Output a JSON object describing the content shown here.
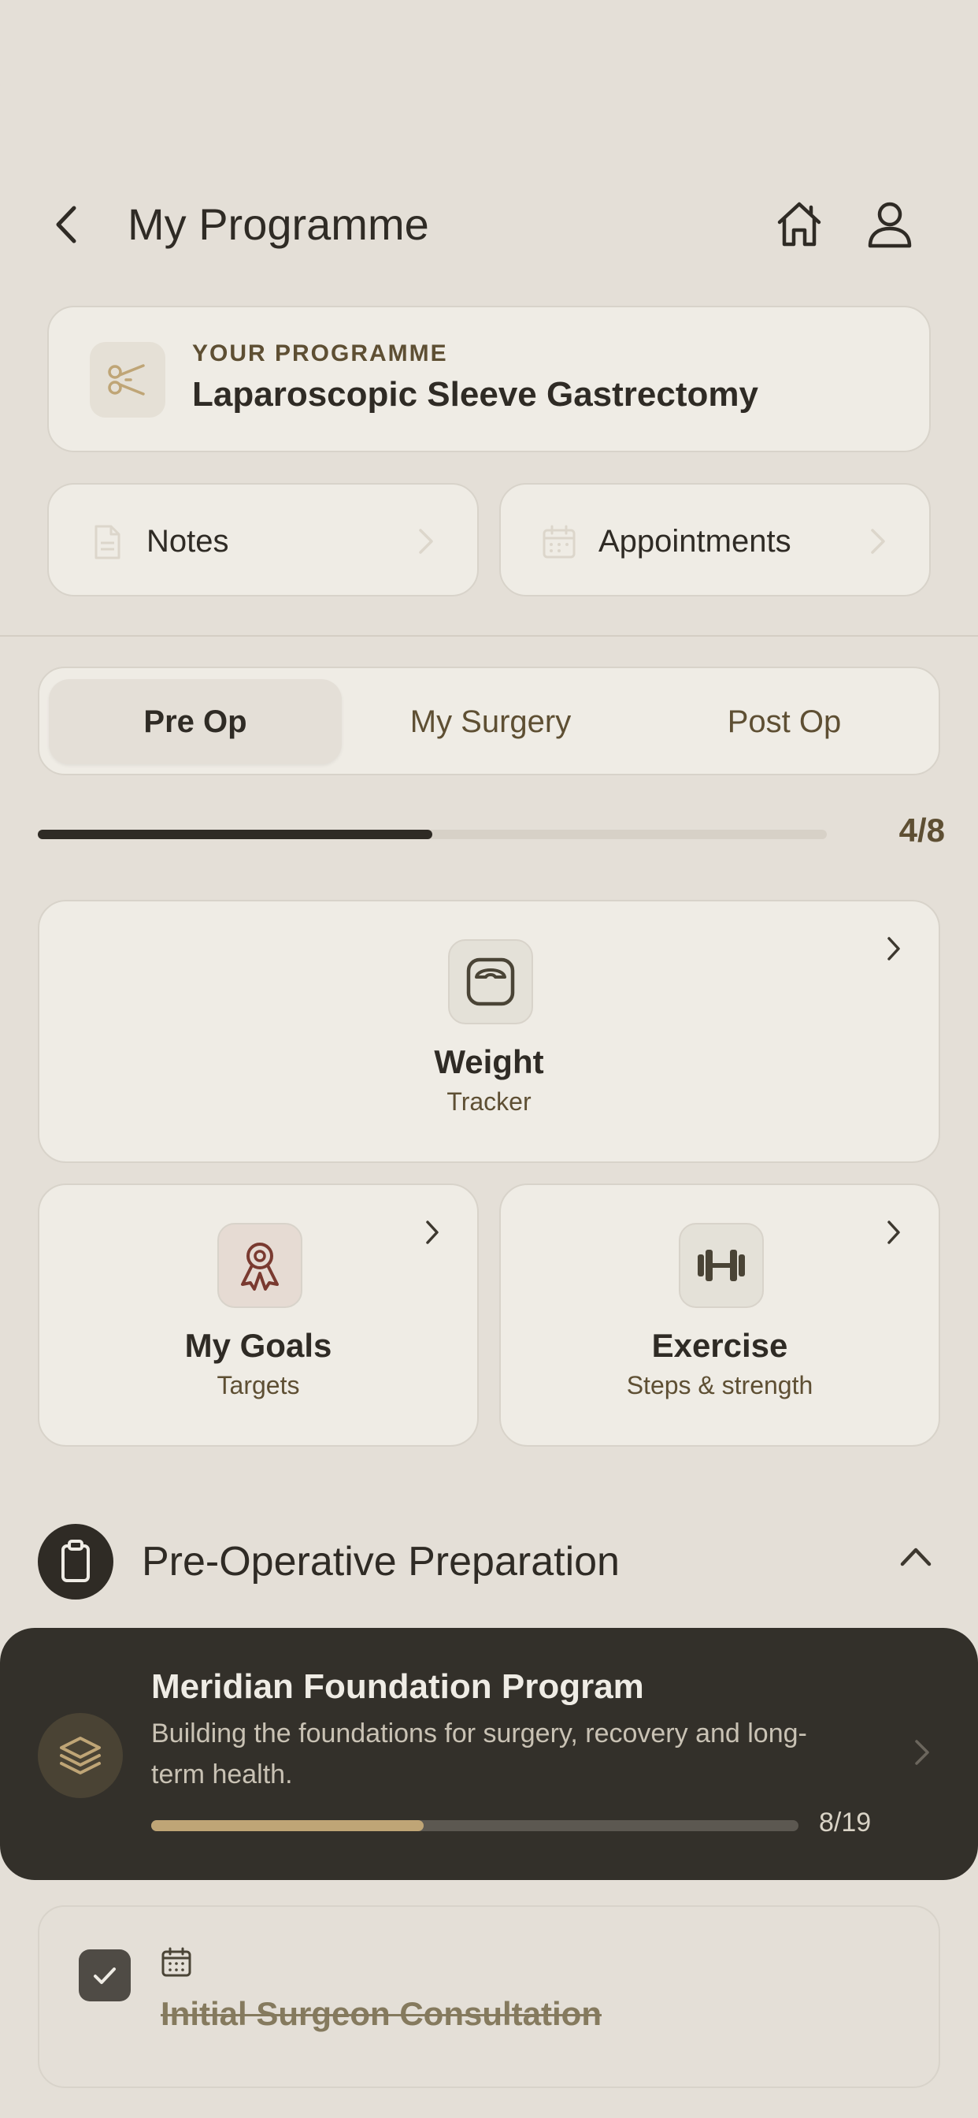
{
  "header": {
    "title": "My Programme",
    "back_icon": "chevron-left-icon",
    "home_icon": "home-icon",
    "profile_icon": "user-icon"
  },
  "programme": {
    "label": "YOUR PROGRAMME",
    "name": "Laparoscopic Sleeve Gastrectomy",
    "icon": "scissors-icon"
  },
  "links": [
    {
      "label": "Notes",
      "icon": "document-icon"
    },
    {
      "label": "Appointments",
      "icon": "calendar-icon"
    }
  ],
  "tabs": [
    {
      "label": "Pre Op",
      "active": true
    },
    {
      "label": "My Surgery",
      "active": false
    },
    {
      "label": "Post Op",
      "active": false
    }
  ],
  "progress": {
    "label": "4/8",
    "value": 4,
    "total": 8
  },
  "tiles": [
    {
      "title": "Weight",
      "subtitle": "Tracker",
      "icon": "scale-icon"
    },
    {
      "title": "My Goals",
      "subtitle": "Targets",
      "icon": "award-ribbon-icon"
    },
    {
      "title": "Exercise",
      "subtitle": "Steps & strength",
      "icon": "dumbbell-icon"
    }
  ],
  "section": {
    "title": "Pre-Operative Preparation",
    "icon": "clipboard-icon",
    "toggle_icon": "chevron-up-icon"
  },
  "program_card": {
    "title": "Meridian Foundation Program",
    "description": "Building the foundations for surgery, recovery and long-term health.",
    "progress_label": "8/19",
    "progress_value": 8,
    "progress_total": 19,
    "icon": "layers-icon"
  },
  "task": {
    "title": "Initial Surgeon Consultation",
    "completed": true,
    "icon": "calendar-icon"
  },
  "colors": {
    "background": "#e4dfd7",
    "card": "#efece5",
    "dark": "#33302a",
    "accent_gold": "#bfa576",
    "text_brown": "#5e4f33",
    "goals_icon": "#7a3a30"
  }
}
